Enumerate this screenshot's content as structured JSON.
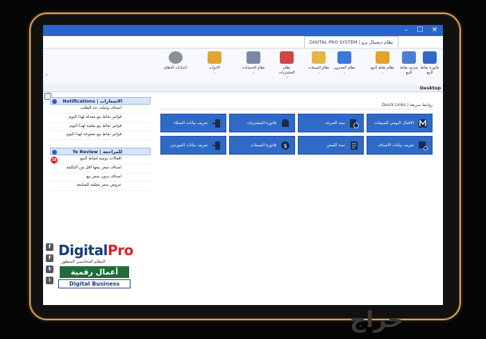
{
  "window": {
    "system_tab": "DIGITAL PRO SYSTEM  |  نظام ديجيتال برو",
    "minimize": "–",
    "maximize": "☐",
    "close": "✕"
  },
  "ribbon": {
    "items": [
      {
        "label": "فاتورة نقاط البيع",
        "icon": "pos-invoice-icon",
        "color": "#2f6bc6"
      },
      {
        "label": "مردود نقاط البيع",
        "icon": "pos-return-icon",
        "color": "#4a7fd0"
      },
      {
        "label": "نظام نقاط البيع",
        "icon": "pos-system-icon",
        "color": "#e2a32a",
        "chevron": "⌄"
      },
      {
        "label": "نظام المخزون",
        "icon": "inventory-icon",
        "color": "#3b78d8",
        "chevron": "⌄"
      },
      {
        "label": "نظام المبيعات",
        "icon": "sales-icon",
        "color": "#e7b547",
        "chevron": "⌄"
      },
      {
        "label": "نظام المشتريات",
        "icon": "purchases-icon",
        "color": "#d04545",
        "chevron": "⌄"
      },
      {
        "label": "نظام الحسابات",
        "icon": "accounts-icon",
        "color": "#7a8aa6",
        "chevron": "⌄"
      },
      {
        "label": "الادوات",
        "icon": "tools-icon",
        "color": "#e1a530",
        "chevron": "⌄"
      },
      {
        "label": "اعدادات النظام",
        "icon": "settings-icon",
        "color": "#8a8f99"
      }
    ]
  },
  "desktop_tab": "Desktop",
  "notifications": {
    "title": "Notifications  |  الاشعارات",
    "items": [
      "اصناف وصلت حد الطلب",
      "فواتير نقاط بيع معدلة لهذا اليوم",
      "فواتير نقاط بيع ملغية لهذا اليوم",
      "فواتير نقاط بيع مفتوحة لهذا اليوم"
    ]
  },
  "review": {
    "title": "To Review  |  للمراجعة",
    "badge": "18",
    "items": [
      "اقفالات يومية لنقاط البيع",
      "اصناف سعر بيعها اقل من التكلفة",
      "اصناف بدون سعر بيع",
      "عروض سعر معلقة للمتابعة"
    ]
  },
  "quick_links": {
    "label": "Quick Links  |  روابط سريعة",
    "row1": [
      "الاقفال اليومي للمبيعات",
      "سند الصرف",
      "فاتورة المشتريات",
      "تعريف بيانات العملاء"
    ],
    "row2": [
      "تعريف بيانات الاصناف",
      "سند القبض",
      "فاتورة المبيعات",
      "تعريف بيانات الموردين"
    ]
  },
  "branding": {
    "digital": "Digital",
    "pro": "Pro",
    "subtitle": "النظام المحاسبي المتطور",
    "aamal": "أعمال رقمية",
    "digital_business": "Digital Business",
    "side_icons": [
      "f",
      "f",
      "t",
      "i"
    ]
  },
  "watermark": "حراج"
}
